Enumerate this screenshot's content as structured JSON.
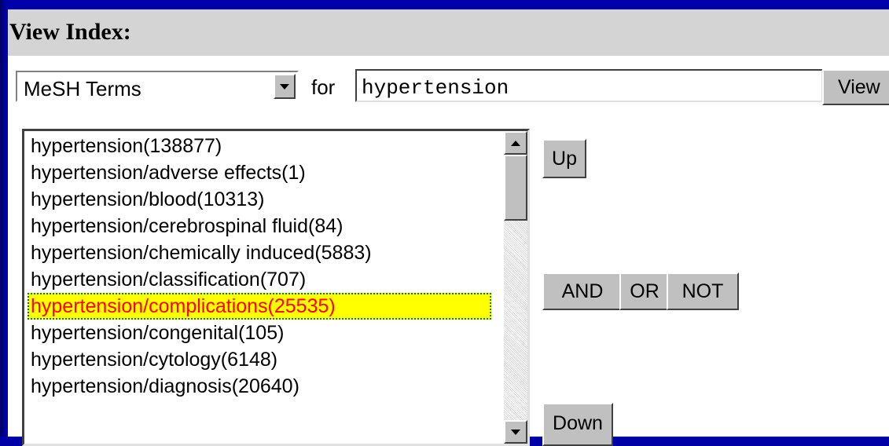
{
  "header": {
    "title": "View Index:"
  },
  "index_select": {
    "value": "MeSH Terms"
  },
  "for_label": "for",
  "search": {
    "value": "hypertension"
  },
  "buttons": {
    "view": "View",
    "up": "Up",
    "and": "AND",
    "or": "OR",
    "not": "NOT",
    "down": "Down"
  },
  "list": {
    "items": [
      {
        "label": "hypertension(138877)"
      },
      {
        "label": "hypertension/adverse effects(1)"
      },
      {
        "label": "hypertension/blood(10313)"
      },
      {
        "label": "hypertension/cerebrospinal fluid(84)"
      },
      {
        "label": "hypertension/chemically induced(5883)"
      },
      {
        "label": "hypertension/classification(707)"
      },
      {
        "label": "hypertension/complications(25535)",
        "selected": true
      },
      {
        "label": "hypertension/congenital(105)"
      },
      {
        "label": "hypertension/cytology(6148)"
      },
      {
        "label": "hypertension/diagnosis(20640)"
      }
    ],
    "selected_index": 6
  },
  "colors": {
    "background": "#000080",
    "header": "#d4d4d4",
    "selected_bg": "#ffff00",
    "selected_text": "#ff0000"
  }
}
